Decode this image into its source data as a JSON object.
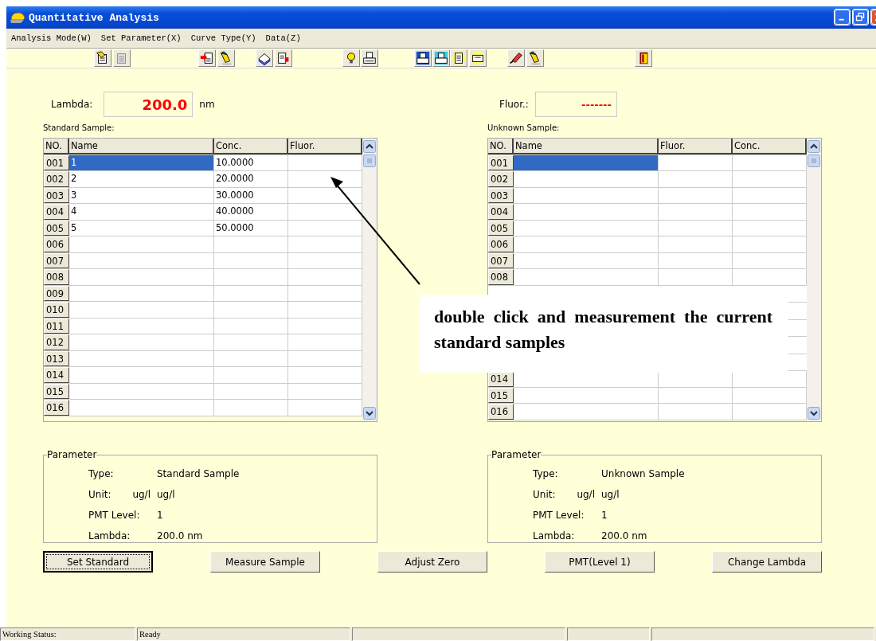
{
  "window": {
    "title": "Quantitative Analysis"
  },
  "menu": [
    {
      "label": "Analysis Mode(W)"
    },
    {
      "label": "Set Parameter(X)"
    },
    {
      "label": "Curve Type(Y)"
    },
    {
      "label": "Data(Z)"
    }
  ],
  "lambda": {
    "label": "Lambda:",
    "value": "200.0",
    "unit": "nm"
  },
  "fluor": {
    "label": "Fluor.:",
    "value": "-------"
  },
  "standard_table": {
    "caption": "Standard Sample:",
    "columns": [
      "NO.",
      "Name",
      "Conc.",
      "Fluor."
    ],
    "rows": [
      {
        "no": "001",
        "name": "1",
        "conc": "10.0000",
        "selected": true
      },
      {
        "no": "002",
        "name": "2",
        "conc": "20.0000",
        "selected": false
      },
      {
        "no": "003",
        "name": "3",
        "conc": "30.0000",
        "selected": false
      },
      {
        "no": "004",
        "name": "4",
        "conc": "40.0000",
        "selected": false
      },
      {
        "no": "005",
        "name": "5",
        "conc": "50.0000",
        "selected": false
      },
      {
        "no": "006",
        "selected": false
      },
      {
        "no": "007",
        "selected": false
      },
      {
        "no": "008",
        "selected": false
      },
      {
        "no": "009",
        "selected": false
      },
      {
        "no": "010",
        "selected": false
      },
      {
        "no": "011",
        "selected": false
      },
      {
        "no": "012",
        "selected": false
      },
      {
        "no": "013",
        "selected": false
      },
      {
        "no": "014",
        "selected": false
      },
      {
        "no": "015",
        "selected": false
      },
      {
        "no": "016",
        "selected": false
      }
    ]
  },
  "unknown_table": {
    "caption": "Unknown Sample:",
    "columns": [
      "NO.",
      "Name",
      "Fluor.",
      "Conc."
    ],
    "rows_above": [
      {
        "no": "001",
        "selected": true
      },
      {
        "no": "002",
        "selected": false
      },
      {
        "no": "003",
        "selected": false
      },
      {
        "no": "004",
        "selected": false
      },
      {
        "no": "005",
        "selected": false
      },
      {
        "no": "006",
        "selected": false
      },
      {
        "no": "007",
        "selected": false
      },
      {
        "no": "008",
        "selected": false
      }
    ],
    "rows_below": [
      {
        "no": "014",
        "selected": false
      },
      {
        "no": "015",
        "selected": false
      },
      {
        "no": "016",
        "selected": false
      }
    ]
  },
  "parameters": [
    {
      "legend": "Parameter",
      "fields": [
        {
          "label": "Type:",
          "value": "Standard Sample"
        },
        {
          "label": "Unit:",
          "unit": "ug/l",
          "value": "ug/l"
        },
        {
          "label": "PMT Level:",
          "value": "1"
        },
        {
          "label": "Lambda:",
          "value": "200.0 nm"
        }
      ]
    },
    {
      "legend": "Parameter",
      "fields": [
        {
          "label": "Type:",
          "value": "Unknown Sample"
        },
        {
          "label": "Unit:",
          "unit": "ug/l",
          "value": "ug/l"
        },
        {
          "label": "PMT Level:",
          "value": "1"
        },
        {
          "label": "Lambda:",
          "value": "200.0 nm"
        }
      ]
    }
  ],
  "buttons": [
    {
      "label": "Set Standard",
      "focused": true
    },
    {
      "label": "Measure Sample",
      "focused": false
    },
    {
      "label": "Adjust Zero",
      "focused": false
    },
    {
      "label": "PMT(Level 1)",
      "focused": false
    },
    {
      "label": "Change Lambda",
      "focused": false
    }
  ],
  "annotation": {
    "text": "double click and measurement the current standard samples"
  },
  "status_bar": {
    "label": "Working Status:",
    "value": "Ready"
  }
}
